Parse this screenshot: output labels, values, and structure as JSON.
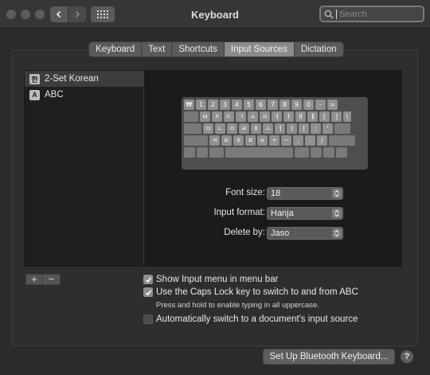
{
  "window": {
    "title": "Keyboard"
  },
  "search": {
    "placeholder": "Search",
    "value": ""
  },
  "tabs": [
    {
      "label": "Keyboard",
      "active": false
    },
    {
      "label": "Text",
      "active": false
    },
    {
      "label": "Shortcuts",
      "active": false
    },
    {
      "label": "Input Sources",
      "active": true
    },
    {
      "label": "Dictation",
      "active": false
    }
  ],
  "sources": [
    {
      "label": "2-Set Korean",
      "icon": "korean-input-icon",
      "glyph": "한",
      "selected": true
    },
    {
      "label": "ABC",
      "icon": "abc-input-icon",
      "glyph": "A",
      "selected": false
    }
  ],
  "keyboard_rows": [
    [
      "₩",
      "1",
      "2",
      "3",
      "4",
      "5",
      "6",
      "7",
      "8",
      "9",
      "0",
      "-",
      "="
    ],
    [
      "",
      "ㅂ",
      "ㅈ",
      "ㄷ",
      "ㄱ",
      "ㅅ",
      "ㅛ",
      "ㅕ",
      "ㅑ",
      "ㅐ",
      "ㅔ",
      "[",
      "]",
      "\\"
    ],
    [
      "",
      "ㅁ",
      "ㄴ",
      "ㅇ",
      "ㄹ",
      "ㅎ",
      "ㅗ",
      "ㅓ",
      "ㅏ",
      "ㅣ",
      ";",
      "'",
      ""
    ],
    [
      "",
      "ㅋ",
      "ㅌ",
      "ㅊ",
      "ㅍ",
      "ㅠ",
      "ㅜ",
      "ㅡ",
      ",",
      ".",
      "/",
      ""
    ],
    [
      "",
      "",
      "",
      "",
      "",
      "",
      "",
      ""
    ]
  ],
  "settings": {
    "font_size_label": "Font size:",
    "font_size_value": "18",
    "input_format_label": "Input format:",
    "input_format_value": "Hanja",
    "delete_by_label": "Delete by:",
    "delete_by_value": "Jaso"
  },
  "list_controls": {
    "add": "+",
    "remove": "−"
  },
  "options": {
    "show_menu": {
      "label": "Show Input menu in menu bar",
      "checked": true
    },
    "caps_lock": {
      "label": "Use the Caps Lock key to switch to and from ABC",
      "checked": true
    },
    "caps_note": "Press and hold to enable typing in all uppercase.",
    "auto_switch": {
      "label": "Automatically switch to a document's input source",
      "checked": false
    }
  },
  "bluetooth_button": "Set Up Bluetooth Keyboard...",
  "help": "?"
}
